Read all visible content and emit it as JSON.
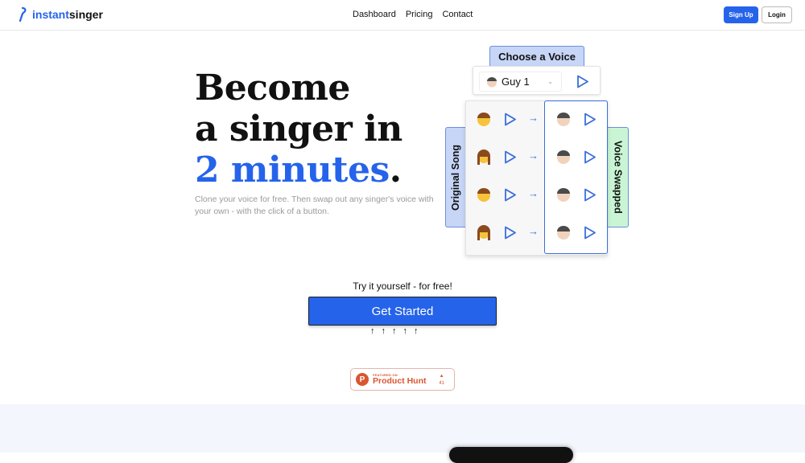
{
  "nav": {
    "logo_accent": "instant",
    "logo_rest": "singer",
    "links": [
      "Dashboard",
      "Pricing",
      "Contact"
    ],
    "signup": "Sign Up",
    "login": "Login"
  },
  "hero": {
    "line1": "Become",
    "line2": "a singer in",
    "line3_accent": "2 minutes",
    "line3_end": ".",
    "subtitle": "Clone your voice for free. Then swap out any singer's voice with your own - with the click of a button."
  },
  "demo": {
    "choose_label": "Choose a Voice",
    "selected_voice": "Guy 1",
    "original_label": "Original Song",
    "swapped_label": "Voice Swapped",
    "rows": [
      {
        "original": "man-face-icon"
      },
      {
        "original": "woman-face-icon"
      },
      {
        "original": "man-face-icon"
      },
      {
        "original": "woman-face-icon"
      }
    ]
  },
  "cta": {
    "try_text": "Try it yourself - for free!",
    "button": "Get Started",
    "arrows": [
      "↑",
      "↑",
      "↑",
      "↑",
      "↑"
    ]
  },
  "product_hunt": {
    "featured": "FEATURED ON",
    "name": "Product Hunt",
    "votes": "41",
    "letter": "P"
  },
  "colors": {
    "accent": "#2563eb",
    "swapped": "#c9f5d4",
    "tab": "#c7d6f7",
    "product_hunt": "#da552f"
  }
}
